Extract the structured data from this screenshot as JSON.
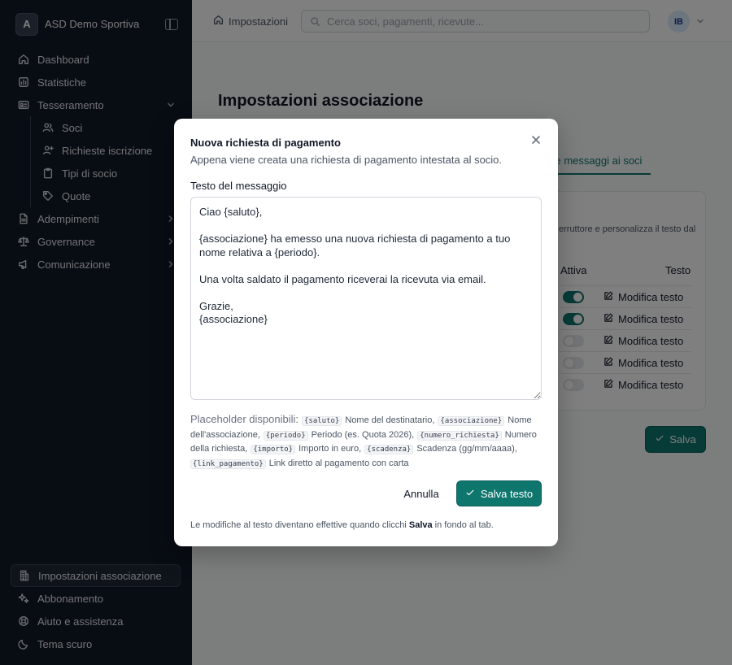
{
  "brand": {
    "initial": "A",
    "name": "ASD Demo Sportiva"
  },
  "sidebar": {
    "items": [
      {
        "label": "Dashboard",
        "icon": "home-icon"
      },
      {
        "label": "Statistiche",
        "icon": "chart-icon"
      },
      {
        "label": "Tesseramento",
        "icon": "id-card-icon",
        "expanded": true
      },
      {
        "label": "Adempimenti",
        "icon": "file-icon"
      },
      {
        "label": "Governance",
        "icon": "scale-icon"
      },
      {
        "label": "Comunicazione",
        "icon": "megaphone-icon"
      }
    ],
    "subitems": [
      {
        "label": "Soci",
        "icon": "users-icon"
      },
      {
        "label": "Richieste iscrizione",
        "icon": "user-plus-icon"
      },
      {
        "label": "Tipi di socio",
        "icon": "clipboard-icon"
      },
      {
        "label": "Quote",
        "icon": "tag-icon"
      }
    ],
    "bottom": [
      {
        "label": "Impostazioni associazione",
        "icon": "building-icon",
        "active": true
      },
      {
        "label": "Abbonamento",
        "icon": "sparkles-icon"
      },
      {
        "label": "Aiuto e assistenza",
        "icon": "lifebuoy-icon"
      },
      {
        "label": "Tema scuro",
        "icon": "moon-icon"
      }
    ]
  },
  "header": {
    "breadcrumb": "Impostazioni",
    "search_placeholder": "Cerca soci, pagamenti, ricevute...",
    "avatar_initials": "IB"
  },
  "page": {
    "title": "Impostazioni associazione",
    "active_tab": "l e messaggi ai soci",
    "card_desc": "erruttore e personalizza il testo dal",
    "col_active": "Attiva",
    "col_text": "Testo",
    "rows": [
      {
        "active": true,
        "edit": "Modifica testo"
      },
      {
        "active": true,
        "edit": "Modifica testo"
      },
      {
        "active": false,
        "edit": "Modifica testo"
      },
      {
        "active": false,
        "edit": "Modifica testo"
      },
      {
        "active": false,
        "edit": "Modifica testo"
      }
    ],
    "save_label": "Salva"
  },
  "modal": {
    "title": "Nuova richiesta di pagamento",
    "description": "Appena viene creata una richiesta di pagamento intestata al socio.",
    "label": "Testo del messaggio",
    "text": "Ciao {saluto},\n\n{associazione} ha emesso una nuova richiesta di pagamento a tuo nome relativa a {periodo}.\n\nUna volta saldato il pagamento riceverai la ricevuta via email.\n\nGrazie,\n{associazione}",
    "placeholders_lead": "Placeholder disponibili:",
    "placeholders": [
      {
        "code": "{saluto}",
        "desc": "Nome del destinatario,"
      },
      {
        "code": "{associazione}",
        "desc": "Nome dell'associazione,"
      },
      {
        "code": "{periodo}",
        "desc": "Periodo (es. Quota 2026),"
      },
      {
        "code": "{numero_richiesta}",
        "desc": "Numero della richiesta,"
      },
      {
        "code": "{importo}",
        "desc": "Importo in euro,"
      },
      {
        "code": "{scadenza}",
        "desc": "Scadenza (gg/mm/aaaa),"
      },
      {
        "code": "{link_pagamento}",
        "desc": "Link diretto al pagamento con carta"
      }
    ],
    "cancel": "Annulla",
    "save": "Salva testo",
    "footer_pre": "Le modifiche al testo diventano effettive quando clicchi ",
    "footer_bold": "Salva",
    "footer_post": " in fondo al tab."
  },
  "colors": {
    "accent": "#0f766e",
    "sidebar_bg": "#111827"
  }
}
